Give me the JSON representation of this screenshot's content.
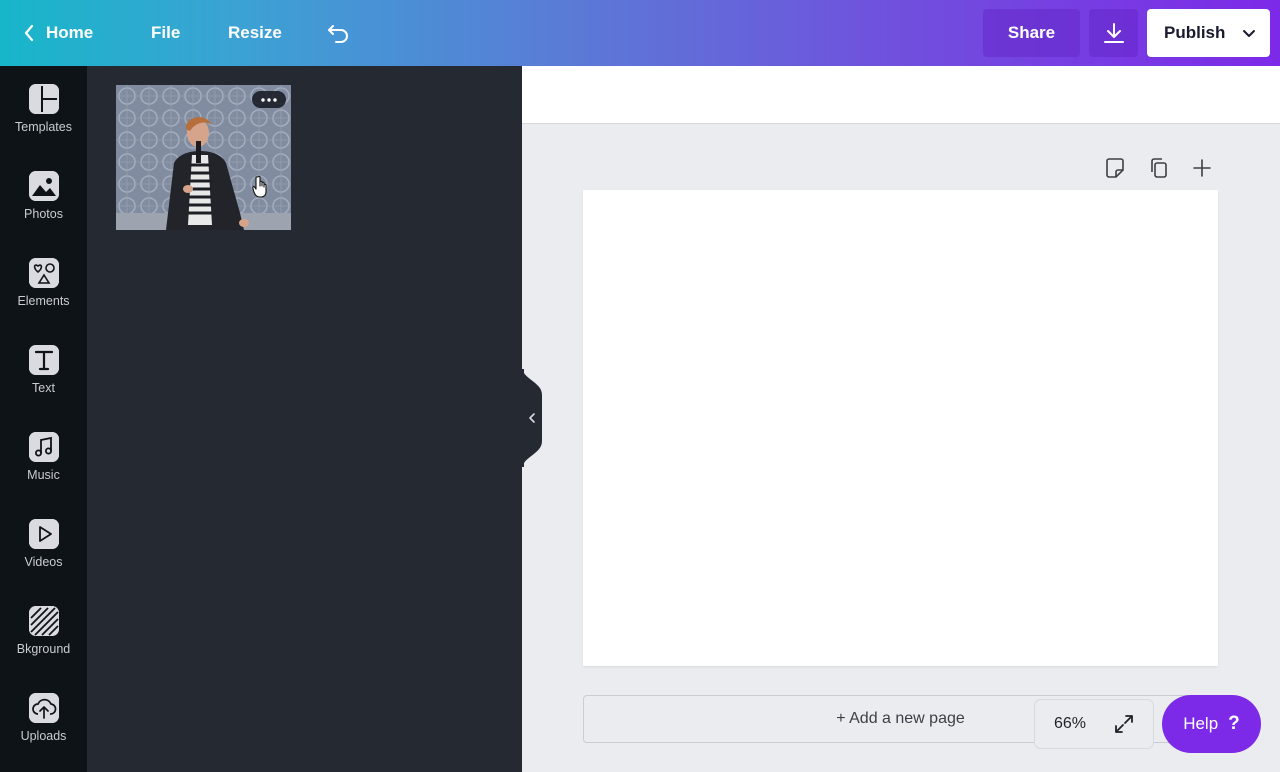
{
  "topbar": {
    "home_label": "Home",
    "file_label": "File",
    "resize_label": "Resize",
    "share_label": "Share",
    "publish_label": "Publish",
    "icons": {
      "back": "chevron-left-icon",
      "undo": "undo-icon",
      "download": "download-icon",
      "publish_menu": "chevron-down-icon"
    }
  },
  "sidebar": {
    "items": [
      {
        "label": "Templates",
        "icon": "templates-icon"
      },
      {
        "label": "Photos",
        "icon": "photos-icon"
      },
      {
        "label": "Elements",
        "icon": "elements-icon"
      },
      {
        "label": "Text",
        "icon": "text-icon"
      },
      {
        "label": "Music",
        "icon": "music-icon"
      },
      {
        "label": "Videos",
        "icon": "videos-icon"
      },
      {
        "label": "Bkground",
        "icon": "background-icon"
      },
      {
        "label": "Uploads",
        "icon": "uploads-icon"
      }
    ]
  },
  "panel": {
    "uploads": [
      {
        "type": "video-thumbnail"
      }
    ]
  },
  "canvas": {
    "add_page_label": "+ Add a new page",
    "zoom_value": "66%"
  },
  "help": {
    "label": "Help",
    "glyph": "?"
  },
  "colors": {
    "accent": "#7d2ae8",
    "gradient_start": "#17b6c9",
    "gradient_end": "#7d2ae8",
    "rail_bg": "#0e1318",
    "panel_bg": "#252932"
  }
}
